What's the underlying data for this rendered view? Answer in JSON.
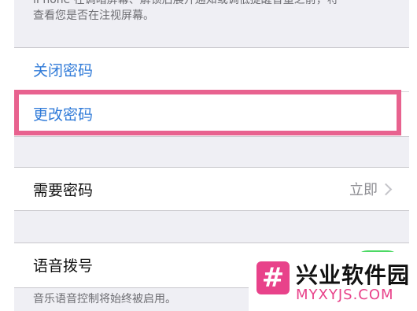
{
  "top_note": {
    "line1": "iPhone 在调暗屏幕、解锁后展开通知或调低提醒音量之前，将",
    "line2": "查看您是否在注视屏幕。"
  },
  "passcode_group": {
    "turn_off": "关闭密码",
    "change": "更改密码"
  },
  "require_passcode": {
    "label": "需要密码",
    "value": "立即"
  },
  "voice_dial": {
    "label": "语音拨号",
    "toggle_on": true,
    "note": "音乐语音控制将始终被启用。"
  },
  "watermark": {
    "logo_glyph": "#",
    "title": "兴业软件园",
    "url": "MYXYJS.COM"
  },
  "colors": {
    "link_blue": "#2f7ad8",
    "highlight_pink": "#e8628f",
    "toggle_green": "#4cd964",
    "brand_pink": "#e8428a"
  }
}
